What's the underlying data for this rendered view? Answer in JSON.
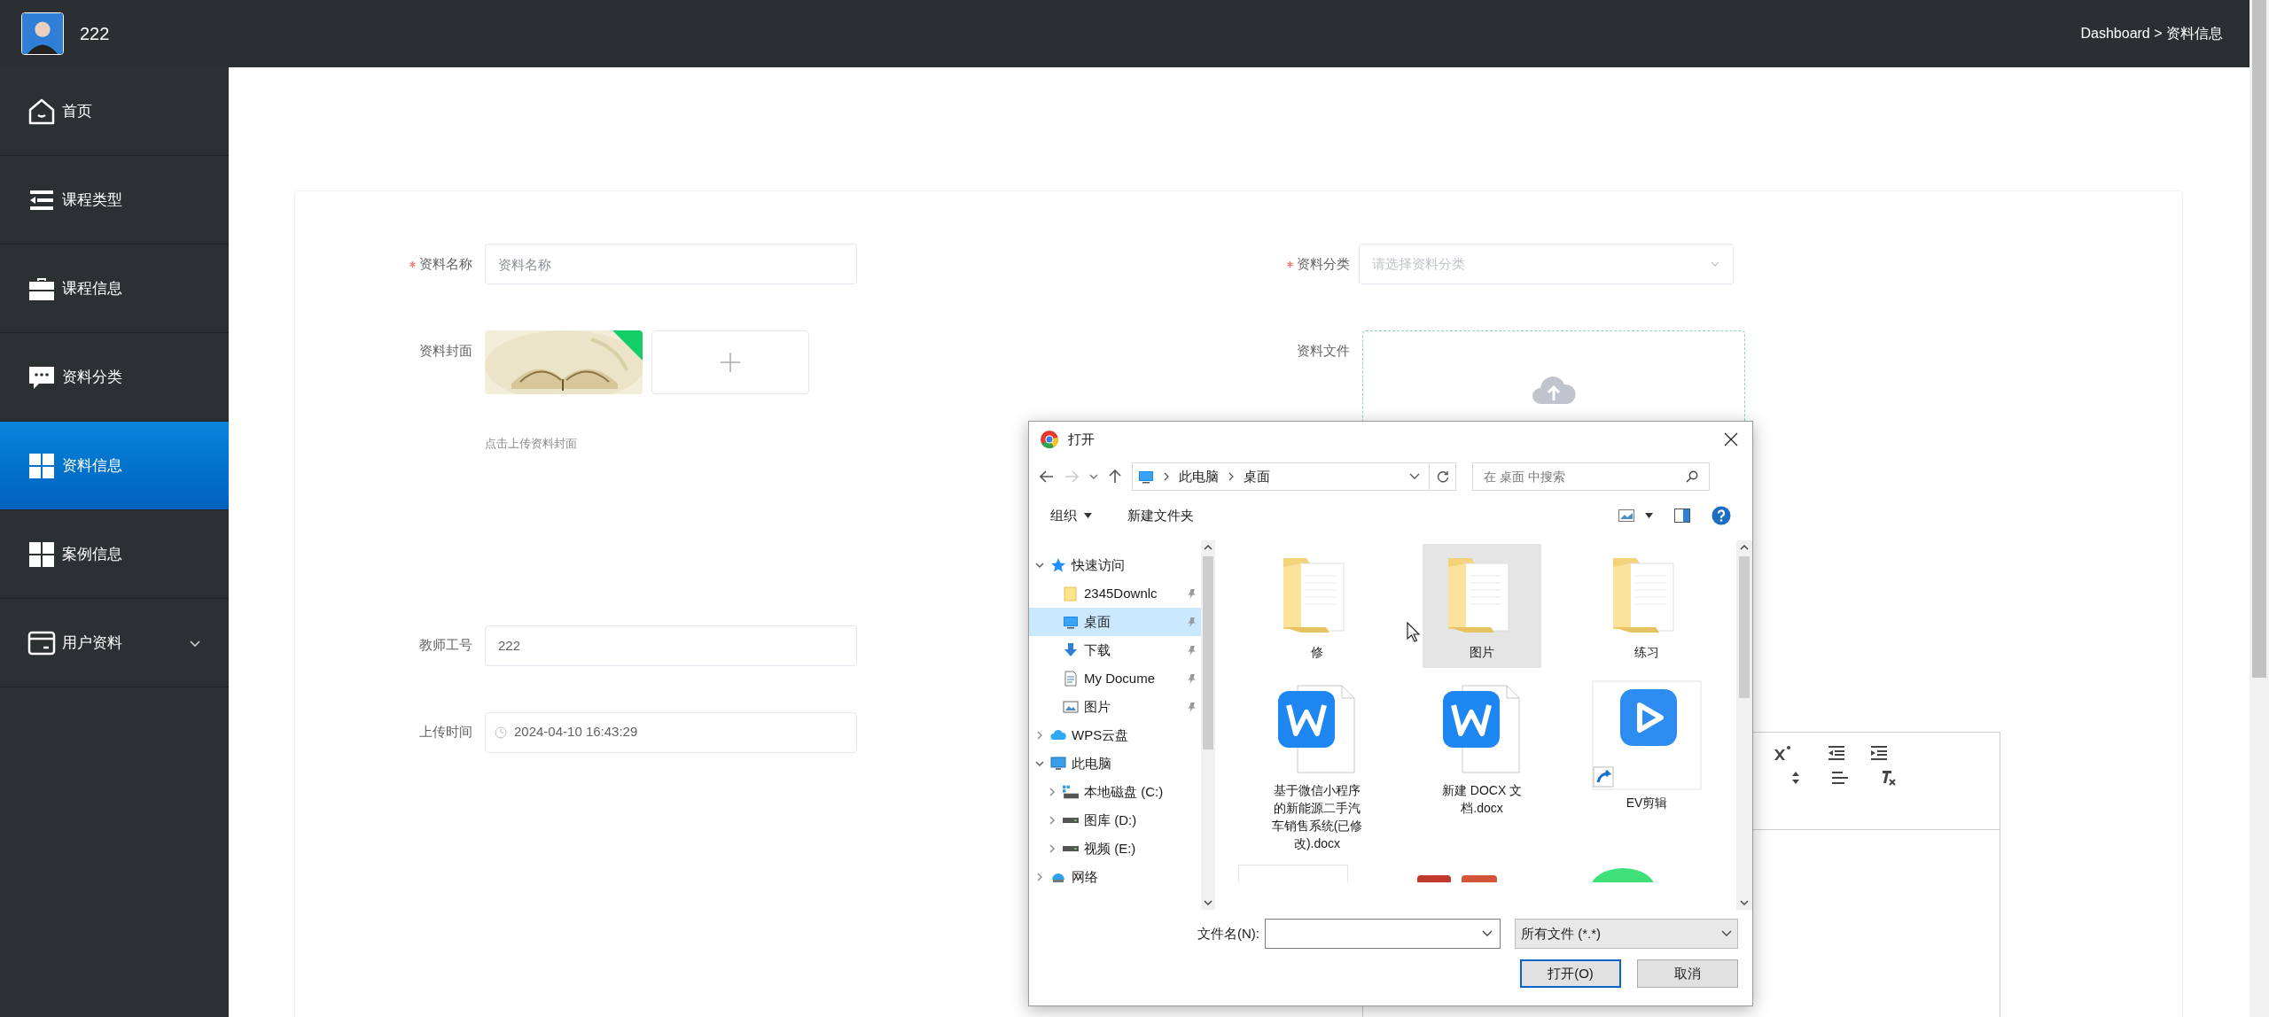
{
  "header": {
    "username": "222",
    "breadcrumb": "Dashboard > 资料信息"
  },
  "sidebar": {
    "items": [
      {
        "label": "首页",
        "selected": false,
        "has_submenu": false
      },
      {
        "label": "课程类型",
        "selected": false,
        "has_submenu": false
      },
      {
        "label": "课程信息",
        "selected": false,
        "has_submenu": false
      },
      {
        "label": "资料分类",
        "selected": false,
        "has_submenu": false
      },
      {
        "label": "资料信息",
        "selected": true,
        "has_submenu": false
      },
      {
        "label": "案例信息",
        "selected": false,
        "has_submenu": false
      },
      {
        "label": "用户资料",
        "selected": false,
        "has_submenu": true
      }
    ]
  },
  "form": {
    "name_field": {
      "label": "资料名称",
      "required": true,
      "placeholder": "资料名称"
    },
    "category_field": {
      "label": "资料分类",
      "required": true,
      "placeholder": "请选择资料分类"
    },
    "cover_field": {
      "label": "资料封面",
      "hint": "点击上传资料封面"
    },
    "file_field": {
      "label": "资料文件"
    },
    "teacher_field": {
      "label": "教师工号",
      "value": "222"
    },
    "time_field": {
      "label": "上传时间",
      "value": "2024-04-10 16:43:29"
    }
  },
  "dialog": {
    "title": "打开",
    "path": [
      "此电脑",
      "桌面"
    ],
    "search_placeholder": "在 桌面 中搜索",
    "toolbar": [
      "组织",
      "新建文件夹"
    ],
    "nav": [
      {
        "label": "快速访问",
        "kind": "star",
        "expanded": true,
        "children": [
          {
            "label": "2345Downlc",
            "kind": "folder",
            "pinned": true,
            "selected": false
          },
          {
            "label": "桌面",
            "kind": "desktop",
            "pinned": true,
            "selected": true
          },
          {
            "label": "下载",
            "kind": "download",
            "pinned": true,
            "selected": false
          },
          {
            "label": "My Docume",
            "kind": "document",
            "pinned": true,
            "selected": false
          },
          {
            "label": "图片",
            "kind": "pictures",
            "pinned": true,
            "selected": false
          }
        ]
      },
      {
        "label": "WPS云盘",
        "kind": "cloud",
        "expanded": false
      },
      {
        "label": "此电脑",
        "kind": "computer",
        "expanded": true,
        "children": [
          {
            "label": "本地磁盘 (C:)",
            "kind": "system-drive",
            "expanded": false
          },
          {
            "label": "图库 (D:)",
            "kind": "drive",
            "expanded": false
          },
          {
            "label": "视频 (E:)",
            "kind": "drive",
            "expanded": false
          }
        ]
      },
      {
        "label": "网络",
        "kind": "network",
        "expanded": false
      }
    ],
    "files": [
      {
        "name": "修",
        "kind": "folder",
        "selected": false
      },
      {
        "name": "图片",
        "kind": "folder",
        "selected": true
      },
      {
        "name": "练习",
        "kind": "folder",
        "selected": false
      },
      {
        "name": "基于微信小程序的新能源二手汽车销售系统(已修改).docx",
        "kind": "doc",
        "selected": false
      },
      {
        "name": "新建 DOCX 文档.docx",
        "kind": "doc",
        "selected": false
      },
      {
        "name": "EV剪辑",
        "kind": "app",
        "selected": false
      }
    ],
    "filename_label": "文件名(N):",
    "filetype": "所有文件 (*.*)",
    "buttons": [
      "打开(O)",
      "取消"
    ]
  }
}
